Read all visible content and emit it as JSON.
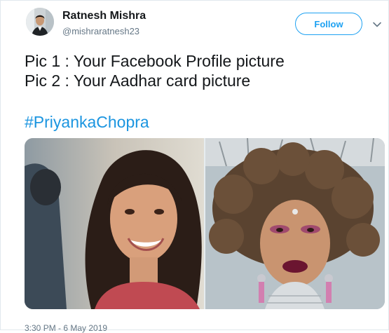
{
  "author": {
    "display_name": "Ratnesh Mishra",
    "handle": "@mishraratnesh23"
  },
  "follow_button": {
    "label": "Follow"
  },
  "tweet": {
    "lines": [
      "Pic 1 : Your Facebook Profile picture",
      "Pic 2 : Your Aadhar card picture"
    ],
    "hashtag": "#PriyankaChopra",
    "timestamp": "3:30 PM - 6 May 2019"
  },
  "media": {
    "left_photo": "smiling-woman-photo",
    "right_photo": "curly-hair-woman-photo"
  },
  "colors": {
    "accent": "#1da1f2",
    "hashtag": "#1b95e0",
    "muted": "#657786",
    "border": "#e1e8ed"
  },
  "icons": [
    "caret-down-icon"
  ]
}
